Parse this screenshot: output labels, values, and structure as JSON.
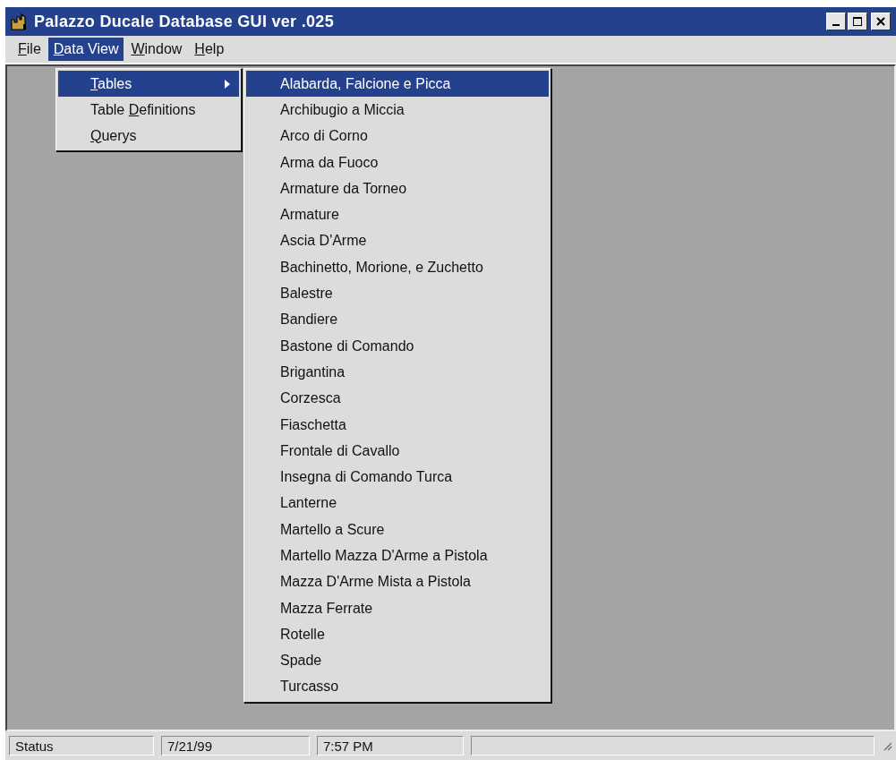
{
  "window": {
    "title": "Palazzo Ducale Database GUI ver .025"
  },
  "menu_bar": [
    {
      "key": "F",
      "after": "ile",
      "selected": false
    },
    {
      "key": "D",
      "after": "ata View",
      "selected": true
    },
    {
      "key": "W",
      "after": "indow",
      "selected": false
    },
    {
      "key": "H",
      "after": "elp",
      "selected": false
    }
  ],
  "dropdown": [
    {
      "key": "T",
      "after": "ables",
      "selected": true,
      "has_submenu": true
    },
    {
      "before": "Table ",
      "key": "D",
      "after": "efinitions",
      "selected": false,
      "has_submenu": false
    },
    {
      "key": "Q",
      "after": "uerys",
      "selected": false,
      "has_submenu": false
    }
  ],
  "submenu": [
    {
      "label": "Alabarda, Falcione e Picca",
      "selected": true
    },
    {
      "label": "Archibugio a Miccia",
      "selected": false
    },
    {
      "label": "Arco di Corno",
      "selected": false
    },
    {
      "label": "Arma da Fuoco",
      "selected": false
    },
    {
      "label": "Armature da Torneo",
      "selected": false
    },
    {
      "label": "Armature",
      "selected": false
    },
    {
      "label": "Ascia D'Arme",
      "selected": false
    },
    {
      "label": "Bachinetto, Morione, e Zuchetto",
      "selected": false
    },
    {
      "label": "Balestre",
      "selected": false
    },
    {
      "label": "Bandiere",
      "selected": false
    },
    {
      "label": "Bastone di Comando",
      "selected": false
    },
    {
      "label": "Brigantina",
      "selected": false
    },
    {
      "label": "Corzesca",
      "selected": false
    },
    {
      "label": "Fiaschetta",
      "selected": false
    },
    {
      "label": "Frontale di Cavallo",
      "selected": false
    },
    {
      "label": "Insegna di Comando Turca",
      "selected": false
    },
    {
      "label": "Lanterne",
      "selected": false
    },
    {
      "label": "Martello a Scure",
      "selected": false
    },
    {
      "label": "Martello Mazza D'Arme a Pistola",
      "selected": false
    },
    {
      "label": "Mazza D'Arme Mista a Pistola",
      "selected": false
    },
    {
      "label": "Mazza Ferrate",
      "selected": false
    },
    {
      "label": "Rotelle",
      "selected": false
    },
    {
      "label": "Spade",
      "selected": false
    },
    {
      "label": "Turcasso",
      "selected": false
    }
  ],
  "status_bar": [
    "Status",
    "7/21/99",
    "7:57 PM"
  ]
}
